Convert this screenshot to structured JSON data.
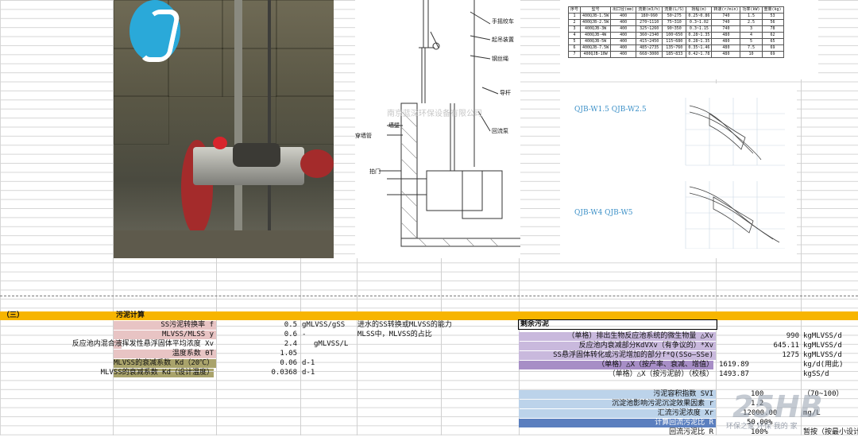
{
  "section": {
    "number": "（三）",
    "title": "污泥计算"
  },
  "photo": {
    "alt": "site photo"
  },
  "diagram": {
    "labels": [
      "手摇绞车",
      "起吊装置",
      "钢丝绳",
      "导杆",
      "穿墙管",
      "墙壁",
      "回流泵",
      "拍门"
    ],
    "watermark": "南京蓝深环保设备有限公司"
  },
  "spec_table": {
    "headers": [
      "序号",
      "型号",
      "出口径(mm)",
      "流量(m3/h)",
      "流量(L/S)",
      "扬程(m)",
      "转速(r/min)",
      "功率(kW)",
      "重量(kg)"
    ],
    "rows": [
      [
        "1",
        "400QJB-1.5W",
        "400",
        "180~990",
        "50~275",
        "0.25~0.86",
        "740",
        "1.5",
        "53"
      ],
      [
        "2",
        "400QJB-2.5W",
        "400",
        "270~1110",
        "75~310",
        "0.3~1.02",
        "740",
        "2.5",
        "56"
      ],
      [
        "3",
        "400QJB-3W",
        "400",
        "325~1260",
        "90~350",
        "0.3~1.15",
        "740",
        "3",
        "78"
      ],
      [
        "4",
        "400QJB-4W",
        "400",
        "360~2340",
        "100~650",
        "0.28~1.35",
        "480",
        "4",
        "62"
      ],
      [
        "5",
        "400QJB-5W",
        "400",
        "415~2450",
        "115~680",
        "0.28~1.35",
        "480",
        "5",
        "65"
      ],
      [
        "6",
        "400QJB-7.5W",
        "400",
        "485~2735",
        "135~760",
        "0.35~1.46",
        "480",
        "7.5",
        "69"
      ],
      [
        "7",
        "400QJB-10W",
        "400",
        "668~3000",
        "185~833",
        "0.42~1.78",
        "480",
        "10",
        "69"
      ]
    ]
  },
  "curves": {
    "title1": "QJB-W1.5  QJB-W2.5",
    "title2": "QJB-W4  QJB-W5"
  },
  "left_params": [
    {
      "label": "SS污泥转换率 f",
      "value": "0.5",
      "unit": "gMLVSS/gSS",
      "note": "进水的SS转换或MLVSS的能力"
    },
    {
      "label": "MLVSS/MLSS y",
      "value": "0.6",
      "unit": "-",
      "note": "MLSS中，MLVSS的占比"
    },
    {
      "label": "反应池内混合液挥发性悬浮固体平均浓度 Xv",
      "value": "2.4",
      "unit": "gMLVSS/L",
      "note": ""
    },
    {
      "label": "温度系数 θT",
      "value": "1.05",
      "unit": "",
      "note": ""
    },
    {
      "label": "MLVSS的衰减系数 Kd（20℃）",
      "value": "0.06",
      "unit": "d-1",
      "note": ""
    },
    {
      "label": "MLVSS的衰减系数 Kd（设计温度）",
      "value": "0.0368",
      "unit": "d-1",
      "note": ""
    }
  ],
  "residual": {
    "header": "剩余污泥",
    "rows": [
      {
        "label": "（单格）排出生物反应池系统的微生物量 △Xv",
        "value": "990",
        "unit": "kgMLVSS/d"
      },
      {
        "label": "反应池内衰减部分KdVXv（有争议的）*Xv",
        "value": "645.11",
        "unit": "kgMLVSS/d"
      },
      {
        "label": "SS悬浮固体转化或污泥增加的部分f*Q(SSo―SSe)",
        "value": "1275",
        "unit": "kgMLVSS/d"
      },
      {
        "label": "（单格）△X（按产率、衰减、增值）",
        "value": "1619.89",
        "unit": "kg/d(用此)"
      },
      {
        "label": "（单格）△X（按污泥龄）（校核）",
        "value": "1493.87",
        "unit": "kgSS/d"
      }
    ],
    "rows2": [
      {
        "label": "污泥容积指数 SVI",
        "value": "100",
        "unit": "（70~100）"
      },
      {
        "label": "沉淀池影响污泥沉淀效果因素 r",
        "value": "1.2",
        "unit": ""
      },
      {
        "label": "汇流污泥浓度 Xr",
        "value": "12000.00",
        "unit": "mg/L"
      },
      {
        "label": "计算回流污泥比 R",
        "value": "50.00%",
        "unit": ""
      },
      {
        "label": "回流污泥比 R",
        "value": "100%",
        "unit": "暂按（按最小设计"
      }
    ]
  },
  "watermark": {
    "text": "25HB",
    "sub": "环保之家 环保 我的 家"
  }
}
